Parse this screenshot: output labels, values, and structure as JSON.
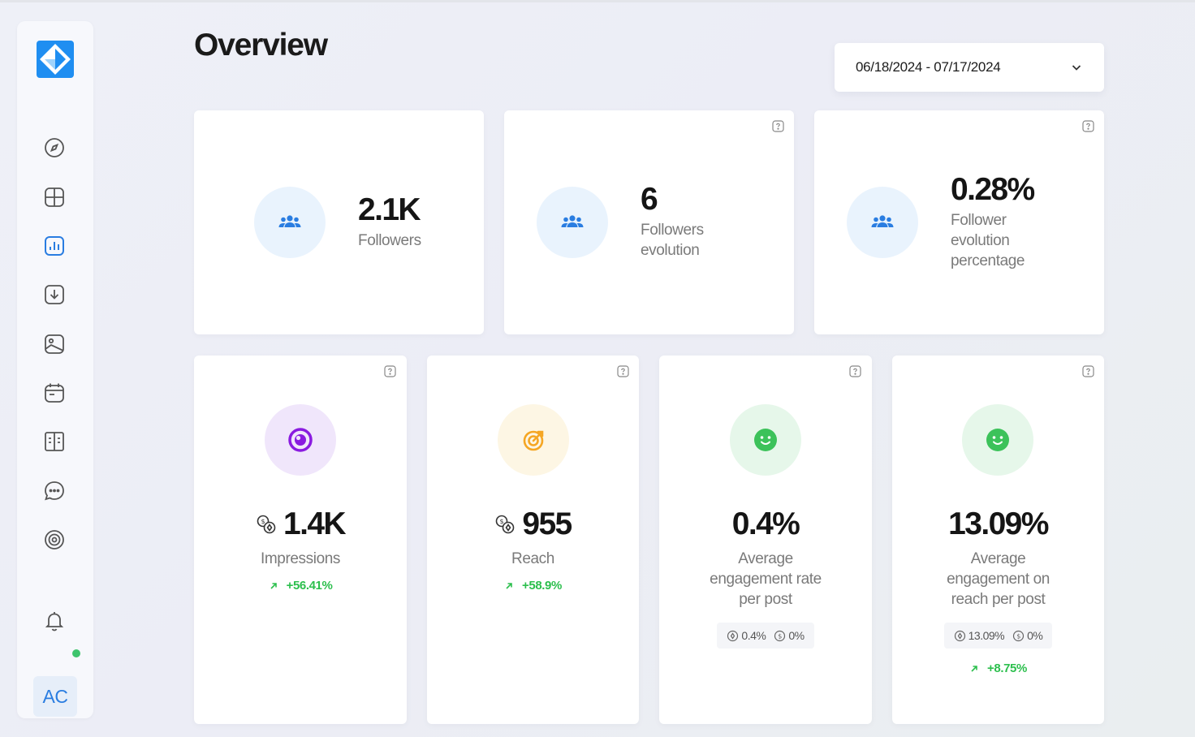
{
  "page": {
    "title": "Overview"
  },
  "date_range": {
    "value": "06/18/2024 - 07/17/2024",
    "icon": "chevron-down-icon"
  },
  "sidebar": {
    "items": [
      {
        "name": "explore",
        "icon": "compass-icon"
      },
      {
        "name": "dashboard",
        "icon": "layout-icon"
      },
      {
        "name": "analytics",
        "icon": "bar-chart-icon",
        "active": true
      },
      {
        "name": "download",
        "icon": "download-icon"
      },
      {
        "name": "media",
        "icon": "image-icon"
      },
      {
        "name": "calendar",
        "icon": "calendar-icon"
      },
      {
        "name": "book",
        "icon": "book-icon"
      },
      {
        "name": "messages",
        "icon": "chat-icon"
      },
      {
        "name": "broadcast",
        "icon": "signal-icon"
      }
    ],
    "notifications_icon": "bell-icon",
    "avatar": "AC"
  },
  "top_cards": [
    {
      "value": "2.1K",
      "label": [
        "Followers"
      ],
      "icon": "users-icon"
    },
    {
      "value": "6",
      "label": [
        "Followers",
        "evolution"
      ],
      "icon": "users-icon"
    },
    {
      "value": "0.28%",
      "label": [
        "Follower",
        "evolution",
        "percentage"
      ],
      "icon": "users-icon"
    }
  ],
  "bottom_cards": [
    {
      "value": "1.4K",
      "label": [
        "Impressions"
      ],
      "trend": "+56.41%",
      "icon": "eye-target-icon"
    },
    {
      "value": "955",
      "label": [
        "Reach"
      ],
      "trend": "+58.9%",
      "icon": "target-icon"
    },
    {
      "value": "0.4%",
      "label": [
        "Average",
        "engagement rate",
        "per post"
      ],
      "pill": [
        "0.4%",
        "0%"
      ],
      "icon": "smile-icon"
    },
    {
      "value": "13.09%",
      "label": [
        "Average",
        "engagement on",
        "reach per post"
      ],
      "pill": [
        "13.09%",
        "0%"
      ],
      "trend": "+8.75%",
      "icon": "smile-icon"
    }
  ],
  "colors": {
    "accent": "#2a7de1",
    "positive": "#2cbf4d",
    "purple": "#8a1be0",
    "yellow": "#f5a623",
    "green": "#3cc25a"
  }
}
